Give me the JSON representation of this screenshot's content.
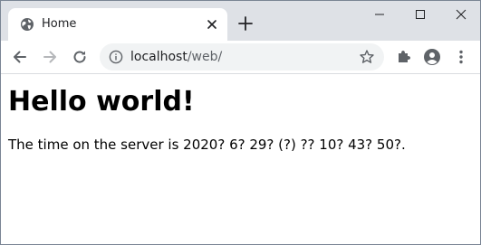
{
  "tab": {
    "title": "Home",
    "favicon": "globe-icon"
  },
  "toolbar": {
    "url_host": "localhost",
    "url_path": "/web/"
  },
  "page": {
    "heading": "Hello world!",
    "body_text": "The time on the server is 2020? 6? 29? (?) ?? 10? 43? 50?."
  },
  "colors": {
    "tabstrip_bg": "#dee1e6",
    "omnibox_bg": "#f1f3f4",
    "icon_gray": "#5f6368"
  }
}
